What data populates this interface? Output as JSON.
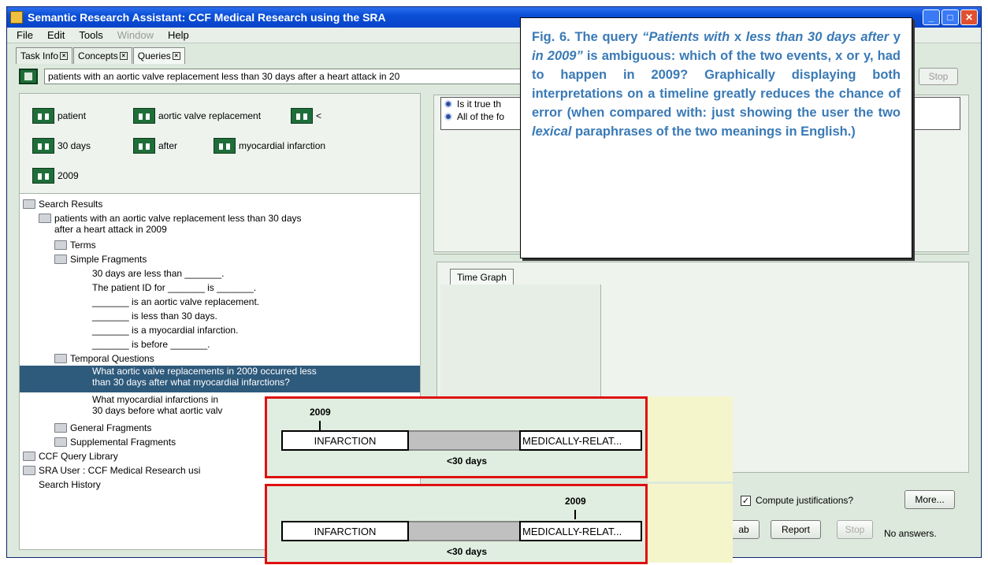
{
  "window": {
    "title": "Semantic Research Assistant: CCF Medical Research using the SRA"
  },
  "menu": [
    "File",
    "Edit",
    "Tools",
    "Window",
    "Help"
  ],
  "tabs": [
    "Task Info",
    "Concepts",
    "Queries"
  ],
  "query": {
    "value": "patients with an aortic valve replacement less than 30 days after a heart attack in 20",
    "stop_label": "Stop"
  },
  "concepts": [
    "patient",
    "aortic valve replacement",
    "<",
    "30 days",
    "after",
    "myocardial infarction",
    "2009"
  ],
  "tree": {
    "search_results": "Search Results",
    "query_line1": "patients with an aortic valve replacement less than 30 days",
    "query_line2": "after a heart attack in 2009",
    "terms": "Terms",
    "simple_fragments": "Simple Fragments",
    "fragments": [
      "30 days are less than _______.",
      "The patient ID for _______ is _______.",
      "_______ is an aortic valve replacement.",
      "_______ is less than 30 days.",
      "_______ is a myocardial infarction.",
      "_______ is before _______."
    ],
    "temporal_questions": "Temporal Questions",
    "tq1_line1": "What aortic valve replacements in 2009 occurred less",
    "tq1_line2": "than 30 days after what myocardial infarctions?",
    "tq2_line1": "What myocardial infarctions in",
    "tq2_line2": "30 days before what aortic valv",
    "general_fragments": "General Fragments",
    "supplemental_fragments": "Supplemental Fragments",
    "ccf_library": "CCF Query Library",
    "sra_user": "SRA User : CCF Medical Research usi",
    "search_history": "Search History"
  },
  "answers": [
    "Is it true th",
    "All of the fo"
  ],
  "time_graph_tab": "Time Graph",
  "controls": {
    "compute_label": "Compute justifications?",
    "more_label": "More...",
    "tab_label": "ab",
    "report_label": "Report",
    "stop_label": "Stop",
    "no_answers": "No answers."
  },
  "caption": {
    "p1": "Fig. 6.  The query ",
    "p2": "“Patients with",
    "p3": " x ",
    "p4": "less than 30 days after",
    "p5": " y ",
    "p6": "in 2009”",
    "p7": " is ambiguous: which of the two events, x or y, had to happen in 2009? Graphically displaying both interpretations on a timeline greatly reduces the chance of error (when compared with: just showing the user the two ",
    "p8": "lexical",
    "p9": " paraphrases of the two meanings in English.)"
  },
  "graph1": {
    "year": "2009",
    "left": "INFARCTION",
    "right": "MEDICALLY-RELAT...",
    "span": "<30 days"
  },
  "graph2": {
    "year": "2009",
    "left": "INFARCTION",
    "right": "MEDICALLY-RELAT...",
    "span": "<30 days"
  }
}
